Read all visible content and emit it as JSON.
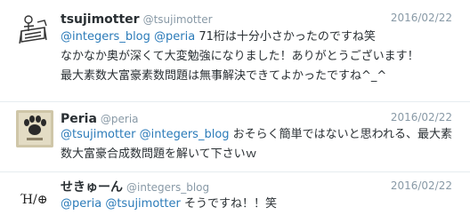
{
  "tweets": [
    {
      "name": "tsujimotter",
      "handle": "@tsujimotter",
      "date": "2016/02/22",
      "line1": {
        "mention1": "@integers_blog",
        "mention2": "@peria",
        "text": " 71桁は十分小さかったのですね笑"
      },
      "line2": "なかなか奥が深くて大変勉強になりました！ありがとうございます！",
      "line3": "最大素数大富豪素数問題は無事解決できてよかったですね^_^"
    },
    {
      "name": "Peria",
      "handle": "@peria",
      "date": "2016/02/22",
      "line1": {
        "mention1": "@tsujimotter",
        "mention2": "@integers_blog",
        "text": " おそらく簡単ではないと思われる、最大素"
      },
      "line2": "数大富豪合成数問題を解いて下さいｗ"
    },
    {
      "name": "せきゅーん",
      "handle": "@integers_blog",
      "date": "2016/02/22",
      "line1": {
        "mention1": "@peria",
        "mention2": "@tsujimotter",
        "text": " そうですね！！笑"
      }
    }
  ],
  "avatars": {
    "tweet1": "avatar-sketch-icon",
    "tweet2": "avatar-paw-icon",
    "tweet3": "avatar-glyph-icon",
    "tweet3_glyph": "Ή/⊕"
  },
  "colors": {
    "mention": "#2b7bb9",
    "meta": "#8899a6",
    "text": "#292f33",
    "divider": "#e6ecf0"
  }
}
